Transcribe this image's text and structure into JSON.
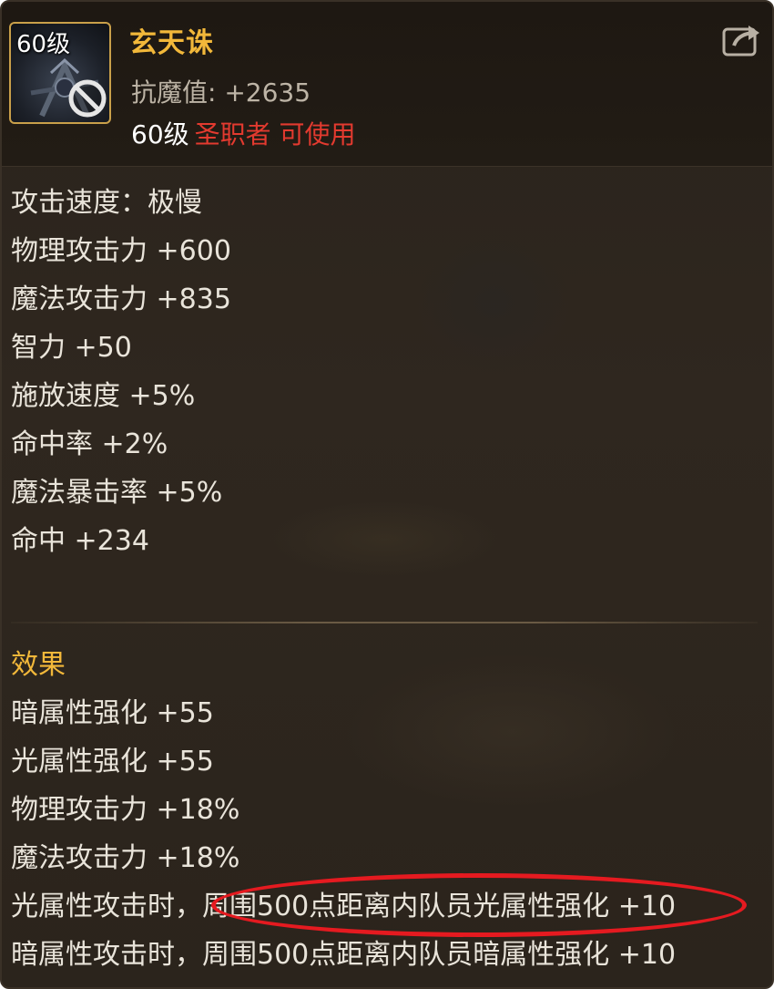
{
  "item": {
    "icon": "dark-cross-weapon-icon",
    "icon_level": "60级",
    "name": "玄天诛",
    "stat": "抗魔值: +2635",
    "required_level": "60级",
    "required_class": "圣职者 可使用",
    "share_icon": "share-icon"
  },
  "colors": {
    "name": "#f2b83a",
    "required_class": "#e33a2f",
    "text": "#e9e4da",
    "highlight": "#e51a20"
  },
  "stats": [
    "攻击速度：极慢",
    "物理攻击力 +600",
    "魔法攻击力 +835",
    "智力 +50",
    "施放速度 +5%",
    "命中率 +2%",
    "魔法暴击率 +5%",
    "命中 +234"
  ],
  "effects_title": "效果",
  "effects": [
    "暗属性强化 +55",
    "光属性强化 +55",
    "物理攻击力 +18%",
    "魔法攻击力 +18%",
    "光属性攻击时，周围500点距离内队员光属性强化 +10",
    "暗属性攻击时，周围500点距离内队员暗属性强化 +10"
  ]
}
